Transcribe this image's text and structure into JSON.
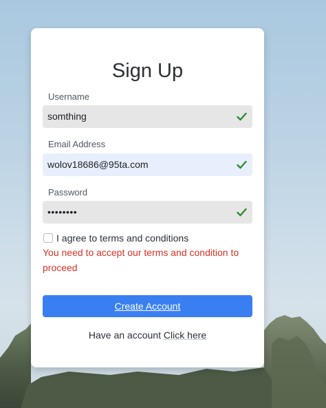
{
  "form": {
    "title": "Sign Up",
    "username": {
      "label": "Username",
      "value": "somthing",
      "valid": true
    },
    "email": {
      "label": "Email Address",
      "value": "wolov18686@95ta.com",
      "valid": true
    },
    "password": {
      "label": "Password",
      "value": "••••••••",
      "valid": true
    },
    "terms": {
      "label": "I agree to terms and conditions",
      "checked": false,
      "error": "You need to accept our terms and condition to proceed"
    },
    "submit_label": "Create Account",
    "footer": {
      "text": "Have an account",
      "link_label": "Click here"
    }
  },
  "colors": {
    "accent": "#3a7ff2",
    "error": "#d93025",
    "valid_check": "#2e8b2e",
    "field_bg": "#e7e6e7",
    "field_focused_bg": "#e8effc"
  },
  "icons": {
    "valid": "check-icon",
    "checkbox": "checkbox-unchecked"
  }
}
